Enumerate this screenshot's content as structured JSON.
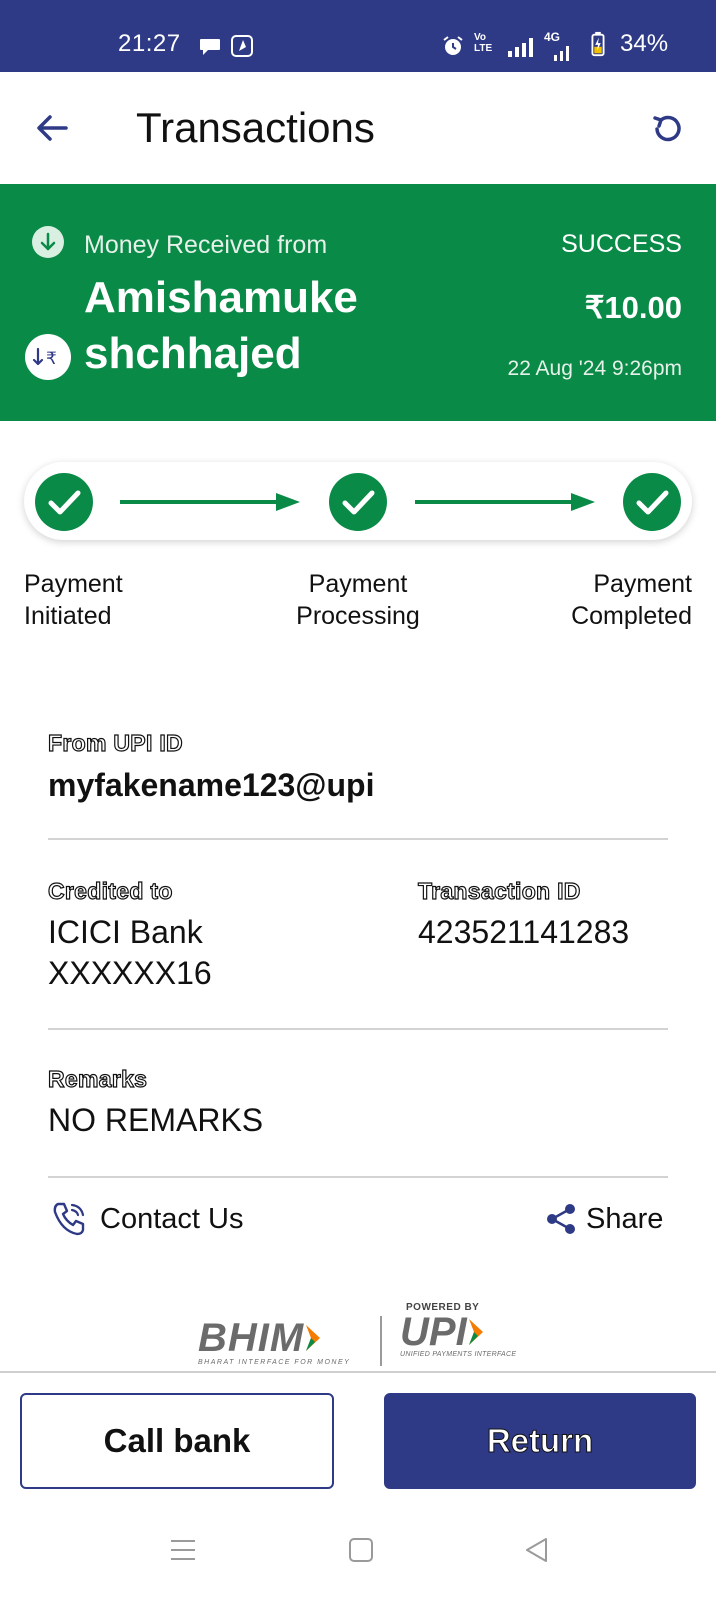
{
  "status_bar": {
    "time": "21:27",
    "battery": "34%",
    "network_label": "4G",
    "volte_label": "Vo LTE",
    "icons": [
      "chat-bubble-icon",
      "app-notification-icon",
      "alarm-icon",
      "volte-icon",
      "signal-icon",
      "signal-4g-icon",
      "battery-icon"
    ]
  },
  "header": {
    "title": "Transactions",
    "back_icon": "arrow-left-icon",
    "refresh_icon": "refresh-icon"
  },
  "banner": {
    "direction_label": "Money Received from",
    "sender_name_line1": "Amishamuke",
    "sender_name_line2": "shchhajed",
    "status": "SUCCESS",
    "amount": "₹10.00",
    "date": "22 Aug '24 9:26pm",
    "color": "#0a8a47"
  },
  "progress": {
    "steps": [
      {
        "line1": "Payment",
        "line2": "Initiated"
      },
      {
        "line1": "Payment",
        "line2": "Processing"
      },
      {
        "line1": "Payment",
        "line2": "Completed"
      }
    ],
    "completed_steps": 3,
    "check_color": "#0a8a47"
  },
  "details": {
    "from_upi_label": "From UPI ID",
    "from_upi_value": "myfakename123@upi",
    "credited_label": "Credited to",
    "credited_line1": "ICICI Bank",
    "credited_line2": "XXXXXX16",
    "txn_label": "Transaction ID",
    "txn_value": "423521141283",
    "remarks_label": "Remarks",
    "remarks_value": "NO REMARKS"
  },
  "actions": {
    "contact_label": "Contact Us",
    "share_label": "Share"
  },
  "branding": {
    "bhim": "BHIM",
    "bhim_tagline": "BHARAT INTERFACE FOR MONEY",
    "powered_by": "POWERED BY",
    "upi": "UPI",
    "upi_tagline": "UNIFIED PAYMENTS INTERFACE"
  },
  "buttons": {
    "call_bank": "Call bank",
    "return": "Return"
  },
  "colors": {
    "primary": "#2e3a86",
    "success": "#0a8a47",
    "divider": "#d3d3d3"
  }
}
